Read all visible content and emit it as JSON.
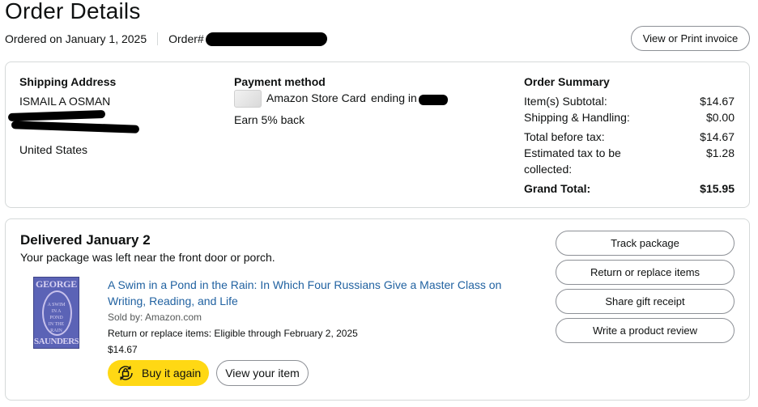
{
  "page": {
    "title": "Order Details"
  },
  "meta": {
    "ordered_label": "Ordered on January 1, 2025",
    "order_label": "Order#"
  },
  "header": {
    "invoice_button": "View or Print invoice"
  },
  "shipping": {
    "title": "Shipping Address",
    "name": "ISMAIL A OSMAN",
    "country": "United States"
  },
  "payment": {
    "title": "Payment method",
    "card_text": "Amazon Store Card",
    "ending_text": "ending in",
    "reward": "Earn 5% back"
  },
  "summary": {
    "title": "Order Summary",
    "rows": [
      {
        "label": "Item(s) Subtotal:",
        "value": "$14.67"
      },
      {
        "label": "Shipping & Handling:",
        "value": "$0.00"
      },
      {
        "label": "Total before tax:",
        "value": "$14.67"
      },
      {
        "label": "Estimated tax to be collected:",
        "value": "$1.28"
      }
    ],
    "grand_label": "Grand Total:",
    "grand_value": "$15.95"
  },
  "shipment": {
    "status": "Delivered January 2",
    "note": "Your package was left near the front door or porch.",
    "item": {
      "title": "A Swim in a Pond in the Rain: In Which Four Russians Give a Master Class on Writing, Reading, and Life",
      "sold_by": "Sold by: Amazon.com",
      "return_text": "Return or replace items: Eligible through February 2, 2025",
      "price": "$14.67",
      "cover_top": "GEORGE",
      "cover_bottom": "SAUNDERS",
      "cover_mid": "A SWIM IN A POND IN THE RAIN"
    },
    "buy_again": "Buy it again",
    "view_item": "View your item",
    "actions": [
      "Track package",
      "Return or replace items",
      "Share gift receipt",
      "Write a product review"
    ]
  },
  "colors": {
    "link": "#2162a1",
    "buy_button": "#ffd814",
    "border": "#d5d9d9"
  },
  "icons": {
    "buy_again": "buy-again-icon"
  }
}
